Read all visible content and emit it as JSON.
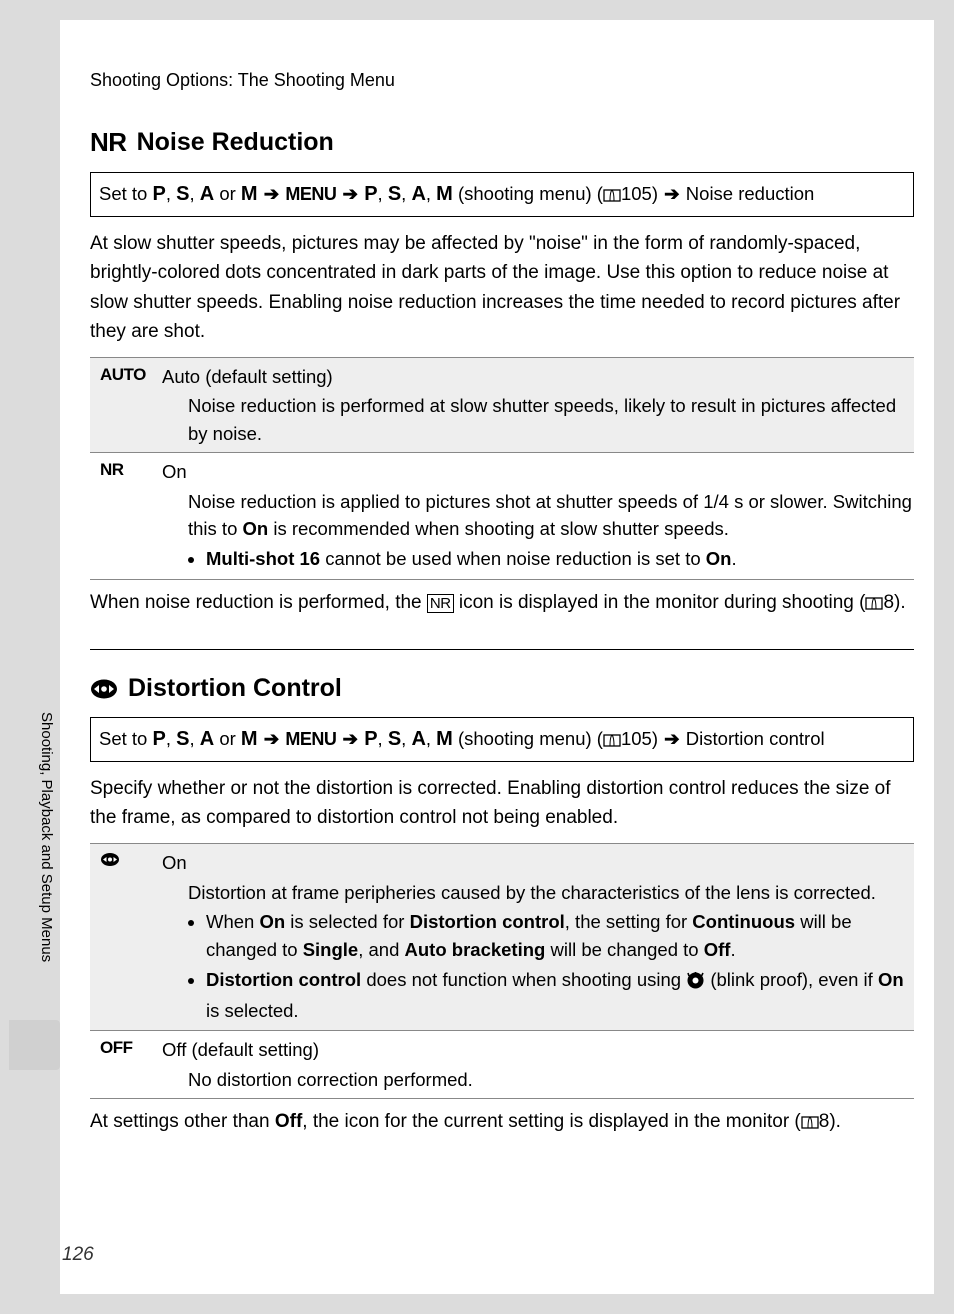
{
  "breadcrumb": "Shooting Options: The Shooting Menu",
  "page_number": "126",
  "sidebar_text": "Shooting, Playback and Setup Menus",
  "sections": {
    "nr": {
      "icon_text": "NR",
      "title": "Noise Reduction",
      "path_prefix": "Set to ",
      "path_modes1": "P, S, A or M",
      "path_menu": "MENU",
      "path_modes2": "P, S, A, M",
      "path_shooting": " (shooting menu) (",
      "path_ref": "105) ",
      "path_target": "Noise reduction",
      "body": "At slow shutter speeds, pictures may be affected by \"noise\" in the form of randomly-spaced, brightly-colored dots concentrated in dark parts of the image. Use this option to reduce noise at slow shutter speeds. Enabling noise reduction increases the time needed to record pictures after they are shot.",
      "opt_auto": {
        "icon": "AUTO",
        "label": "Auto (default setting)",
        "desc": "Noise reduction is performed at slow shutter speeds, likely to result in pictures affected by noise."
      },
      "opt_on": {
        "icon": "NR",
        "label": "On",
        "desc_line1_a": "Noise reduction is applied to pictures shot at shutter speeds of 1/4 s or slower. Switching this to ",
        "desc_line1_b": "On",
        "desc_line1_c": " is recommended when shooting at slow shutter speeds.",
        "bullet_a": "Multi-shot 16",
        "bullet_b": " cannot be used when noise reduction is set to ",
        "bullet_c": "On",
        "bullet_d": "."
      },
      "after_a": "When noise reduction is performed, the ",
      "after_b": " icon is displayed in the monitor during shooting (",
      "after_c": "8)."
    },
    "dc": {
      "title": "Distortion Control",
      "path_prefix": "Set to ",
      "path_modes1": "P, S, A or M",
      "path_menu": "MENU",
      "path_modes2": "P, S, A, M",
      "path_shooting": " (shooting menu) (",
      "path_ref": "105) ",
      "path_target": "Distortion control",
      "body": "Specify whether or not the distortion is corrected. Enabling distortion control reduces the size of the frame, as compared to distortion control not being enabled.",
      "opt_on": {
        "label": "On",
        "desc_line1": "Distortion at frame peripheries caused by the characteristics of the lens is corrected.",
        "b1_a": "When ",
        "b1_b": "On",
        "b1_c": " is selected for ",
        "b1_d": "Distortion control",
        "b1_e": ", the setting for ",
        "b1_f": "Continuous",
        "b1_g": " will be changed to ",
        "b1_h": "Single",
        "b1_i": ", and ",
        "b1_j": "Auto bracketing",
        "b1_k": " will be changed to ",
        "b1_l": "Off",
        "b1_m": ".",
        "b2_a": "Distortion control",
        "b2_b": " does not function when shooting using ",
        "b2_c": " (blink proof), even if ",
        "b2_d": "On",
        "b2_e": " is selected."
      },
      "opt_off": {
        "icon": "OFF",
        "label": "Off (default setting)",
        "desc": "No distortion correction performed."
      },
      "after_a": "At settings other than ",
      "after_b": "Off",
      "after_c": ", the icon for the current setting is displayed in the monitor (",
      "after_d": "8)."
    }
  }
}
